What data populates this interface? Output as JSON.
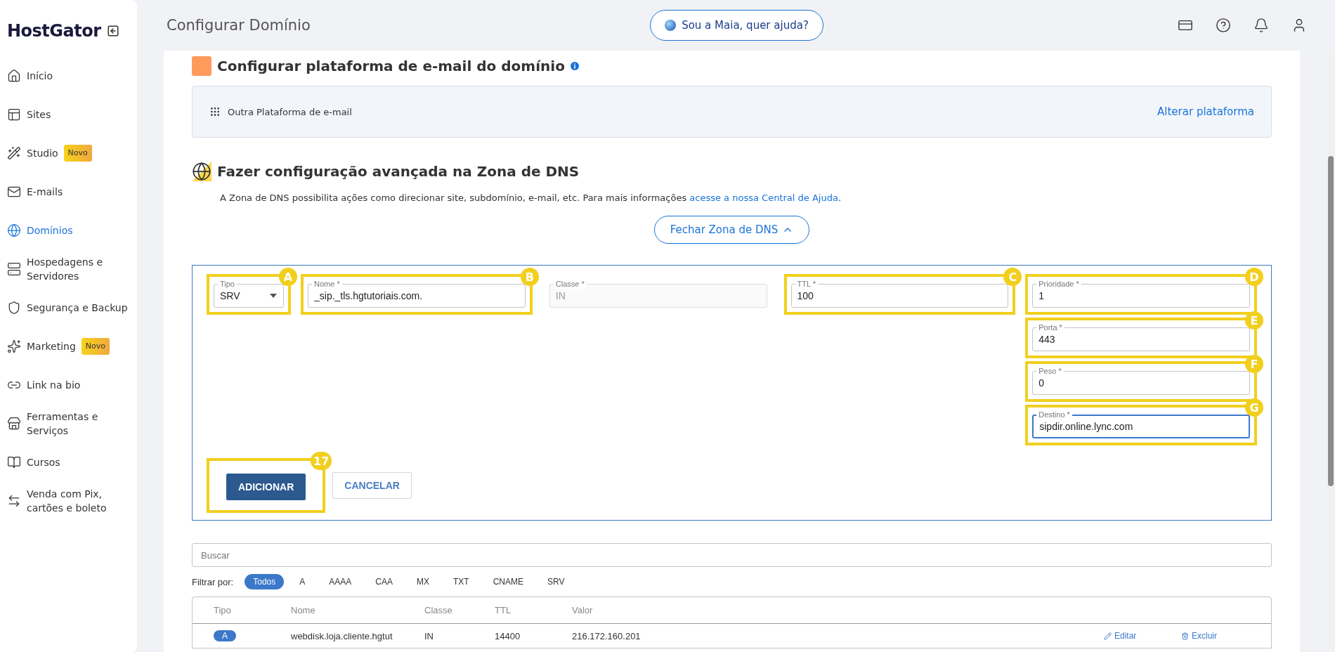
{
  "sidebar": {
    "logo": "HostGator",
    "items": [
      {
        "label": "Início",
        "selected": false
      },
      {
        "label": "Sites",
        "selected": false
      },
      {
        "label": "Studio",
        "selected": false,
        "badge": "Novo"
      },
      {
        "label": "E-mails",
        "selected": false
      },
      {
        "label": "Domínios",
        "selected": true
      },
      {
        "label": "Hospedagens e Servidores",
        "selected": false
      },
      {
        "label": "Segurança e Backup",
        "selected": false
      },
      {
        "label": "Marketing",
        "selected": false,
        "badge": "Novo"
      },
      {
        "label": "Link na bio",
        "selected": false
      },
      {
        "label": "Ferramentas e Serviços",
        "selected": false
      },
      {
        "label": "Cursos",
        "selected": false
      },
      {
        "label": "Venda com Pix, cartões e boleto",
        "selected": false
      }
    ]
  },
  "header": {
    "title": "Configurar Domínio",
    "assistant_button": "Sou a Maia, quer ajuda?"
  },
  "email_section": {
    "title": "Configurar plataforma de e-mail do domínio",
    "platform": "Outra Plataforma de e-mail",
    "change_link": "Alterar plataforma"
  },
  "dns_section": {
    "title": "Fazer configuração avançada na Zona de DNS",
    "description": "A Zona de DNS possibilita ações como direcionar site, subdomínio, e-mail, etc. Para mais informações ",
    "help_link": "acesse a nossa Central de Ajuda",
    "description_end": ".",
    "toggle_button": "Fechar Zona de DNS"
  },
  "form": {
    "fields": [
      {
        "kind": "select",
        "label": "Tipo",
        "value": "SRV",
        "disabled": false,
        "focused": false,
        "marker": "A"
      },
      {
        "kind": "text",
        "label": "Nome *",
        "value": "_sip._tls.hgtutoriais.com.",
        "disabled": false,
        "focused": false,
        "marker": "B"
      },
      {
        "kind": "text",
        "label": "Classe *",
        "value": "IN",
        "disabled": true,
        "focused": false
      },
      {
        "kind": "text",
        "label": "TTL *",
        "value": "100",
        "disabled": false,
        "focused": false,
        "marker": "C"
      },
      {
        "kind": "text",
        "label": "Prioridade *",
        "value": "1",
        "disabled": false,
        "focused": false,
        "marker": "D"
      },
      {
        "kind": "text",
        "label": "Porta *",
        "value": "443",
        "disabled": false,
        "focused": false,
        "marker": "E"
      },
      {
        "kind": "text",
        "label": "Peso *",
        "value": "0",
        "disabled": false,
        "focused": false,
        "marker": "F"
      },
      {
        "kind": "text",
        "label": "Destino *",
        "value": "sipdir.online.lync.com",
        "disabled": false,
        "focused": true,
        "marker": "G"
      }
    ],
    "buttons": [
      {
        "kind": "primary",
        "label": "ADICIONAR",
        "marker": "17"
      },
      {
        "kind": "secondary",
        "label": "CANCELAR"
      }
    ]
  },
  "search": {
    "placeholder": "Buscar"
  },
  "filter": {
    "label": "Filtrar por:",
    "options": [
      {
        "label": "Todos",
        "selected": true
      },
      {
        "label": "A",
        "selected": false
      },
      {
        "label": "AAAA",
        "selected": false
      },
      {
        "label": "CAA",
        "selected": false
      },
      {
        "label": "MX",
        "selected": false
      },
      {
        "label": "TXT",
        "selected": false
      },
      {
        "label": "CNAME",
        "selected": false
      },
      {
        "label": "SRV",
        "selected": false
      }
    ]
  },
  "table": {
    "columns": [
      "Tipo",
      "Nome",
      "Classe",
      "TTL",
      "Valor"
    ],
    "rows": [
      {
        "type": "A",
        "name": "webdisk.loja.cliente.hgtut",
        "class": "IN",
        "ttl": "14400",
        "value": "216.172.160.201",
        "edit": "Editar",
        "delete": "Excluir"
      }
    ]
  }
}
